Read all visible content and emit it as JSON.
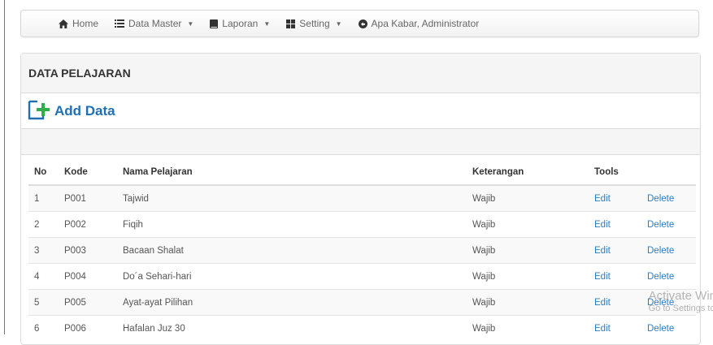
{
  "nav": {
    "home": "Home",
    "data_master": "Data Master",
    "laporan": "Laporan",
    "setting": "Setting",
    "greeting": "Apa Kabar, Administrator"
  },
  "panel": {
    "title": "DATA PELAJARAN",
    "add_label": "Add Data"
  },
  "table": {
    "headers": [
      "No",
      "Kode",
      "Nama Pelajaran",
      "Keterangan",
      "Tools",
      ""
    ],
    "rows": [
      {
        "no": "1",
        "kode": "P001",
        "nama": "Tajwid",
        "ket": "Wajib",
        "edit": "Edit",
        "delete": "Delete"
      },
      {
        "no": "2",
        "kode": "P002",
        "nama": "Fiqih",
        "ket": "Wajib",
        "edit": "Edit",
        "delete": "Delete"
      },
      {
        "no": "3",
        "kode": "P003",
        "nama": "Bacaan Shalat",
        "ket": "Wajib",
        "edit": "Edit",
        "delete": "Delete"
      },
      {
        "no": "4",
        "kode": "P004",
        "nama": "Do´a Sehari-hari",
        "ket": "Wajib",
        "edit": "Edit",
        "delete": "Delete"
      },
      {
        "no": "5",
        "kode": "P005",
        "nama": "Ayat-ayat Pilihan",
        "ket": "Wajib",
        "edit": "Edit",
        "delete": "Delete"
      },
      {
        "no": "6",
        "kode": "P006",
        "nama": "Hafalan Juz 30",
        "ket": "Wajib",
        "edit": "Edit",
        "delete": "Delete"
      }
    ]
  },
  "watermark": {
    "line1": "Activate Win",
    "line2": "Go to Settings tc"
  },
  "colors": {
    "link": "#2a7dc5",
    "add_label": "#1f6fb2",
    "add_plus": "#2fae4a"
  }
}
